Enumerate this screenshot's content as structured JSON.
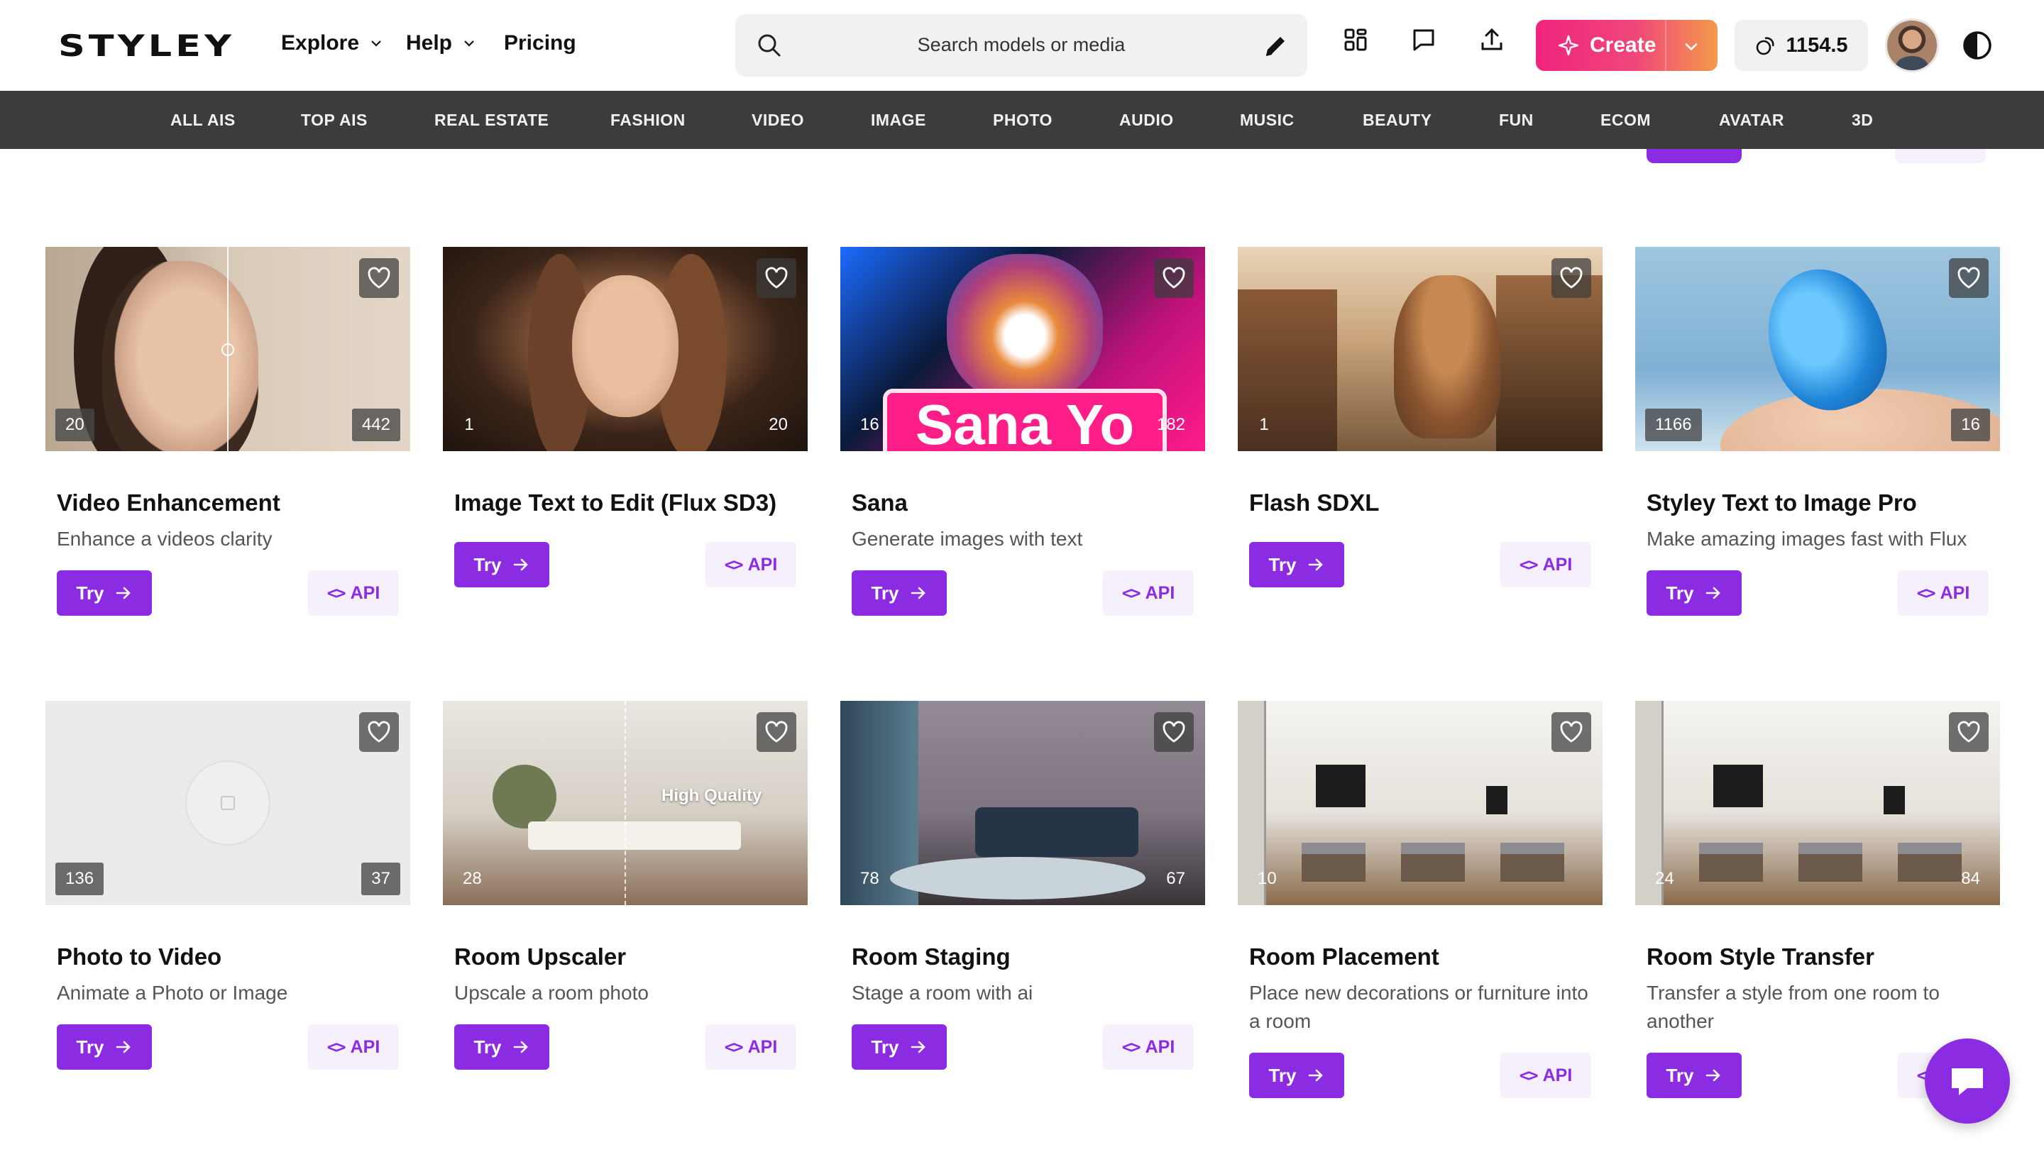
{
  "brand": {
    "logo": "STYLEY",
    "accent": "#8b2be2",
    "create_gradient": [
      "#f0237e",
      "#f39a4a"
    ]
  },
  "nav": {
    "explore": "Explore",
    "help": "Help",
    "pricing": "Pricing"
  },
  "search": {
    "placeholder": "Search models or media"
  },
  "header_icons": [
    "grid-icon",
    "chat-icon",
    "upload-icon"
  ],
  "create": {
    "label": "Create"
  },
  "credits": {
    "value": "1154.5"
  },
  "categories": [
    "ALL AIS",
    "TOP AIS",
    "REAL ESTATE",
    "FASHION",
    "VIDEO",
    "IMAGE",
    "PHOTO",
    "AUDIO",
    "MUSIC",
    "BEAUTY",
    "FUN",
    "ECOM",
    "AVATAR",
    "3D"
  ],
  "common": {
    "try": "Try",
    "api": "API"
  },
  "cards": [
    {
      "title": "Video Enhancement",
      "description": "Enhance a videos clarity",
      "left_count": "20",
      "right_count": "442"
    },
    {
      "title": "Image Text to Edit (Flux SD3)",
      "description": "",
      "left_count": "1",
      "right_count": "20"
    },
    {
      "title": "Sana",
      "description": "Generate images with text",
      "left_count": "16",
      "right_count": "182",
      "thumb_text": "Sana Yo"
    },
    {
      "title": "Flash SDXL",
      "description": "",
      "left_count": "1",
      "right_count": ""
    },
    {
      "title": "Styley Text to Image Pro",
      "description": "Make amazing images fast with Flux",
      "left_count": "1166",
      "right_count": "16"
    },
    {
      "title": "Photo to Video",
      "description": "Animate a Photo or Image",
      "left_count": "136",
      "right_count": "37"
    },
    {
      "title": "Room Upscaler",
      "description": "Upscale a room photo",
      "left_count": "28",
      "right_count": "",
      "thumb_text": "High Quality"
    },
    {
      "title": "Room Staging",
      "description": "Stage a room with ai",
      "left_count": "78",
      "right_count": "67"
    },
    {
      "title": "Room Placement",
      "description": "Place new decorations or furniture into a room",
      "left_count": "10",
      "right_count": ""
    },
    {
      "title": "Room Style Transfer",
      "description": "Transfer a style from one room to another",
      "left_count": "24",
      "right_count": "84"
    }
  ]
}
